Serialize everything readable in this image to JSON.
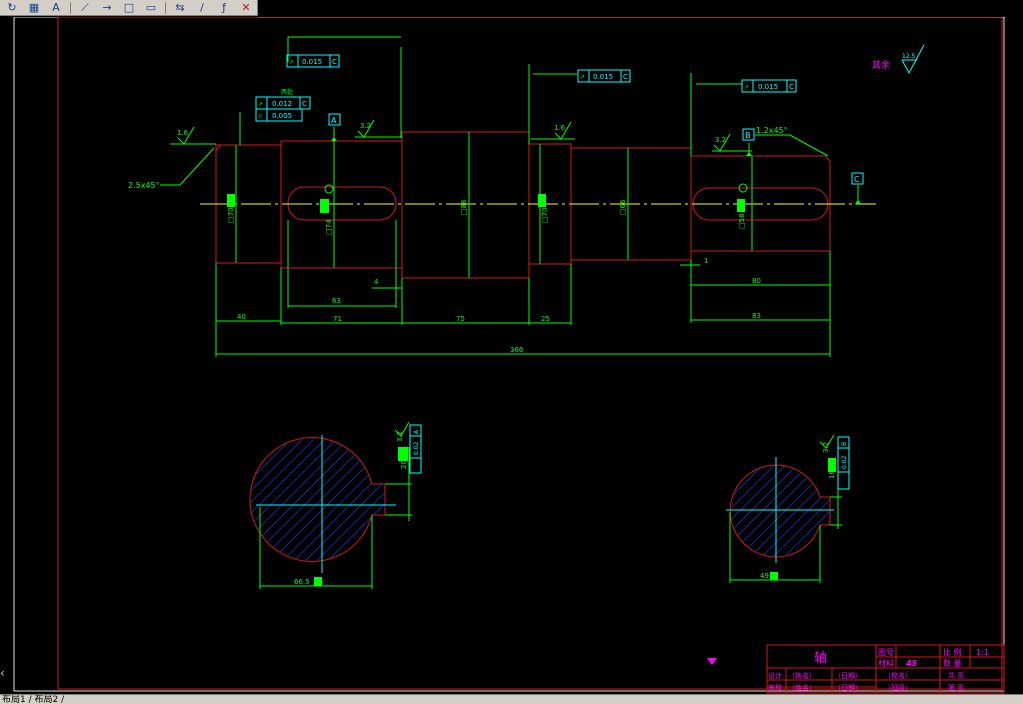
{
  "toolbar": {
    "buttons": [
      {
        "name": "redraw-icon",
        "glyph": "↻"
      },
      {
        "name": "table-icon",
        "glyph": "▦"
      },
      {
        "name": "text-style-icon",
        "glyph": "A"
      },
      {
        "name": "leader-icon",
        "glyph": "⟋"
      },
      {
        "name": "arrow-leader-icon",
        "glyph": "→"
      },
      {
        "name": "rectangle-icon",
        "glyph": "□"
      },
      {
        "name": "square-icon",
        "glyph": "▭"
      },
      {
        "name": "align-icon",
        "glyph": "⇆"
      },
      {
        "name": "slash-icon",
        "glyph": "/"
      },
      {
        "name": "stroke-icon",
        "glyph": "ƒ"
      },
      {
        "name": "erase-icon",
        "glyph": "✕"
      }
    ]
  },
  "drawing": {
    "roughness_rest_label": "其余",
    "roughness_rest_value": "12.5",
    "tolerance_1": {
      "value": "0.015",
      "datum": "C"
    },
    "tolerance_2": {
      "value": "0.012",
      "datum": "C"
    },
    "tolerance_2_note": "两处",
    "tolerance_3": {
      "value": "0.005"
    },
    "tolerance_4": {
      "value": "0.015",
      "datum": "C"
    },
    "tolerance_5": {
      "value": "0.015",
      "datum": "C"
    },
    "datum_a": "A",
    "datum_b": "B",
    "datum_c": "C",
    "rough_1": "1.6",
    "rough_2": "3.2",
    "rough_3": "1.6",
    "rough_4": "3.2",
    "chamfer_left": "2.5x45°",
    "chamfer_right": "1.2x45°",
    "dia_1": "□70",
    "dia_2": "□74",
    "dia_3": "□86",
    "dia_4": "□70",
    "dia_5": "□66",
    "dia_6": "□58",
    "dim_63": "63",
    "dim_4": "4",
    "dim_1": "1",
    "dim_80": "80",
    "dim_40": "40",
    "dim_71": "71",
    "dim_75": "75",
    "dim_25": "25",
    "dim_83": "83",
    "dim_366": "366",
    "section_left": {
      "dim_width": "66.5",
      "dim_key": "20",
      "rough": "3.2",
      "tol_value": "0.02",
      "tol_datum": "A"
    },
    "section_right": {
      "dim_width": "49",
      "dim_key": "16",
      "rough": "3.2",
      "tol_value": "0.02",
      "tol_datum": "B"
    }
  },
  "title_block": {
    "part_name": "轴",
    "label_drawing_no": "图号",
    "label_material": "材料",
    "material": "45",
    "label_scale": "比 例",
    "scale": "1:1",
    "label_qty": "数 量",
    "label_design": "设计",
    "label_check": "审核",
    "name_placeholder": "（姓名）",
    "date_placeholder": "（日期）",
    "school": "（校名）",
    "class_name": "（班级）",
    "total_pages": "共    页",
    "page_no": "第    页"
  },
  "status": {
    "layout_tabs": "布局1 / 布局2 /"
  },
  "colors": {
    "outline": "#d01818",
    "dimension": "#00ff00",
    "center": "#ffff00",
    "tolerance": "#00ffff",
    "text_magenta": "#ff00ff",
    "hatch": "#2040ff"
  }
}
